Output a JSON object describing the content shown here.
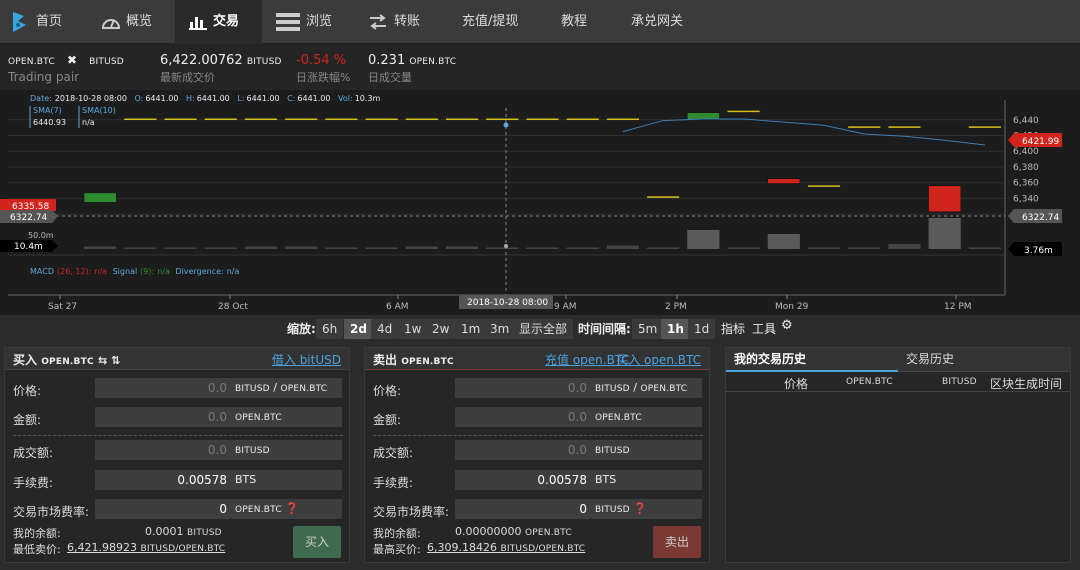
{
  "nav": {
    "home": "首页",
    "overview": "概览",
    "exchange": "交易",
    "explorer": "浏览",
    "transfer": "转账",
    "deposit": "充值/提现",
    "tutorial": "教程",
    "gateway": "承兑网关"
  },
  "market": {
    "base": "OPEN.BTC",
    "quote": "BITUSD",
    "pair_label": "Trading pair",
    "last_price": "6,422.00762",
    "last_price_unit": "BITUSD",
    "last_price_label": "最新成交价",
    "change": "-0.54 %",
    "change_label": "日涨跌幅%",
    "volume": "0.231",
    "volume_unit": "OPEN.BTC",
    "volume_label": "日成交量"
  },
  "chart_data": {
    "type": "candlestick",
    "info": {
      "date_label": "Date:",
      "date": "2018-10-28 08:00",
      "o_label": "O:",
      "o": "6441.00",
      "h_label": "H:",
      "h": "6441.00",
      "l_label": "L:",
      "l": "6441.00",
      "c_label": "C:",
      "c": "6441.00",
      "vol_label": "Vol:",
      "vol": "10.3m"
    },
    "sma7_label": "SMA(7)",
    "sma7_value": "6440.93",
    "sma10_label": "SMA(10)",
    "sma10_value": "n/a",
    "y_ticks": [
      "6,440",
      "6,420",
      "6,400",
      "6,380",
      "6,360",
      "6,340",
      "6,320"
    ],
    "ylim": [
      6310,
      6455
    ],
    "current_price_tag": "6421.99",
    "crosshair_price_tag": "6322.74",
    "left_price_tag": "6322.74",
    "left_red_tag": "6335.58",
    "vol_axis_label": "50.0m",
    "vol_left_tag": "10.4m",
    "vol_right_tag": "3.76m",
    "macd_label": "MACD",
    "macd_params": "(26, 12):",
    "macd_value": "n/a",
    "signal_label": "Signal",
    "signal_params": "(9):",
    "signal_value": "n/a",
    "divergence_label": "Divergence:",
    "divergence_value": "n/a",
    "x_ticks": [
      "Sat 27",
      "28 Oct",
      "6 AM",
      "9 AM",
      "2 PM",
      "Mon 29",
      "12 PM"
    ],
    "crosshair_time": "2018-10-28 08:00",
    "candles": [
      {
        "o": 6335,
        "c": 6347,
        "h": 6347,
        "l": 6335,
        "v": 0.5
      },
      {
        "o": 6441,
        "c": 6441,
        "h": 6441,
        "l": 6441,
        "v": 0.3
      },
      {
        "o": 6441,
        "c": 6441,
        "h": 6441,
        "l": 6441,
        "v": 0.3
      },
      {
        "o": 6441,
        "c": 6441,
        "h": 6441,
        "l": 6441,
        "v": 0.3
      },
      {
        "o": 6441,
        "c": 6441,
        "h": 6441,
        "l": 6441,
        "v": 0.5
      },
      {
        "o": 6441,
        "c": 6441,
        "h": 6441,
        "l": 6441,
        "v": 0.5
      },
      {
        "o": 6441,
        "c": 6441,
        "h": 6441,
        "l": 6441,
        "v": 0.3
      },
      {
        "o": 6441,
        "c": 6441,
        "h": 6441,
        "l": 6441,
        "v": 0.3
      },
      {
        "o": 6441,
        "c": 6441,
        "h": 6441,
        "l": 6441,
        "v": 0.5
      },
      {
        "o": 6441,
        "c": 6441,
        "h": 6441,
        "l": 6441,
        "v": 0.5
      },
      {
        "o": 6441,
        "c": 6441,
        "h": 6441,
        "l": 6441,
        "v": 0.3
      },
      {
        "o": 6441,
        "c": 6441,
        "h": 6441,
        "l": 6441,
        "v": 0.3
      },
      {
        "o": 6441,
        "c": 6441,
        "h": 6441,
        "l": 6441,
        "v": 0.3
      },
      {
        "o": 6441,
        "c": 6441,
        "h": 6441,
        "l": 6441,
        "v": 0.7
      },
      {
        "o": 6342,
        "c": 6342,
        "h": 6342,
        "l": 6342,
        "v": 0.3
      },
      {
        "o": 6440,
        "c": 6449,
        "h": 6449,
        "l": 6440,
        "v": 3.8
      },
      {
        "o": 6451,
        "c": 6451,
        "h": 6451,
        "l": 6451,
        "v": 0.3
      },
      {
        "o": 6365,
        "c": 6359,
        "h": 6365,
        "l": 6359,
        "v": 3.0
      },
      {
        "o": 6356,
        "c": 6356,
        "h": 6356,
        "l": 6356,
        "v": 0.3
      },
      {
        "o": 6431,
        "c": 6431,
        "h": 6431,
        "l": 6431,
        "v": 0.3
      },
      {
        "o": 6431,
        "c": 6431,
        "h": 6431,
        "l": 6431,
        "v": 1.0
      },
      {
        "o": 6356,
        "c": 6323,
        "h": 6356,
        "l": 6323,
        "v": 6.2
      },
      {
        "o": 6431,
        "c": 6431,
        "h": 6431,
        "l": 6431,
        "v": 0.3
      }
    ],
    "sma7": [
      null,
      null,
      null,
      null,
      null,
      null,
      null,
      null,
      null,
      null,
      null,
      null,
      null,
      6425,
      6439,
      6441,
      6441,
      6437,
      6433,
      6422,
      6419,
      6414,
      6408
    ],
    "sma10": [
      null,
      null,
      null,
      null,
      null,
      null,
      null,
      null,
      null,
      null,
      null,
      null,
      null,
      null,
      null,
      null,
      null,
      null,
      null,
      null,
      null,
      null,
      null
    ]
  },
  "toolbar": {
    "zoom_label": "缩放:",
    "zooms": [
      "6h",
      "2d",
      "4d",
      "1w",
      "2w",
      "1m",
      "3m",
      "显示全部"
    ],
    "interval_label": "时间间隔:",
    "intervals": [
      "5m",
      "1h",
      "1d"
    ],
    "indicators": "指标",
    "tools": "工具"
  },
  "buy": {
    "title": "买入",
    "title_asset": "OPEN.BTC",
    "title_icons": "⇆ ⇅",
    "link": "借入 bitUSD",
    "price_label": "价格:",
    "price_placeholder": "0.0",
    "price_unit_a": "BITUSD",
    "price_unit_b": "OPEN.BTC",
    "amount_label": "金额:",
    "amount_placeholder": "0.0",
    "amount_unit": "OPEN.BTC",
    "total_label": "成交额:",
    "total_placeholder": "0.0",
    "total_unit": "BITUSD",
    "fee_label": "手续费:",
    "fee_value": "0.00578",
    "fee_unit": "BTS",
    "market_fee_label": "交易市场费率:",
    "market_fee_value": "0",
    "market_fee_unit": "OPEN.BTC",
    "balance_label": "我的余额:",
    "balance_value": "0.0001",
    "balance_unit": "BITUSD",
    "best_label": "最低卖价:",
    "best_value": "6,421.98923",
    "best_unit": "BITUSD/OPEN.BTC",
    "button": "买入"
  },
  "sell": {
    "title": "卖出",
    "title_asset": "OPEN.BTC",
    "link1": "充值 open.BTC",
    "link2": "买入 open.BTC",
    "price_label": "价格:",
    "price_placeholder": "0.0",
    "price_unit_a": "BITUSD",
    "price_unit_b": "OPEN.BTC",
    "amount_label": "金额:",
    "amount_placeholder": "0.0",
    "amount_unit": "OPEN.BTC",
    "total_label": "成交额:",
    "total_placeholder": "0.0",
    "total_unit": "BITUSD",
    "fee_label": "手续费:",
    "fee_value": "0.00578",
    "fee_unit": "BTS",
    "market_fee_label": "交易市场费率:",
    "market_fee_value": "0",
    "market_fee_unit": "BITUSD",
    "balance_label": "我的余额:",
    "balance_value": "0.00000000",
    "balance_unit": "OPEN.BTC",
    "best_label": "最高买价:",
    "best_value": "6,309.18426",
    "best_unit": "BITUSD/OPEN.BTC",
    "button": "卖出"
  },
  "history": {
    "tab_mine": "我的交易历史",
    "tab_all": "交易历史",
    "col_price": "价格",
    "col_base": "OPEN.BTC",
    "col_quote": "BITUSD",
    "col_time": "区块生成时间"
  },
  "colors": {
    "up": "#2e8b2e",
    "down": "#d0241c",
    "link": "#4aa3df",
    "buy_button": "#3e6a4e",
    "sell_button": "#7a3a33"
  }
}
